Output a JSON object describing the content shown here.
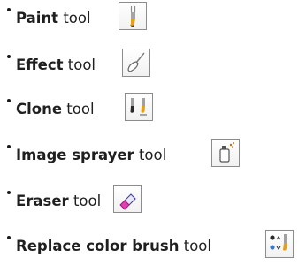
{
  "tool_list": {
    "items": [
      {
        "name": "Paint",
        "suffix": "tool",
        "icon": "paint-brush-icon"
      },
      {
        "name": "Effect",
        "suffix": "tool",
        "icon": "effect-brush-icon"
      },
      {
        "name": "Clone",
        "suffix": "tool",
        "icon": "clone-brushes-icon"
      },
      {
        "name": "Image sprayer",
        "suffix": "tool",
        "icon": "image-sprayer-icon"
      },
      {
        "name": "Eraser",
        "suffix": "tool",
        "icon": "eraser-icon"
      },
      {
        "name": "Replace color brush",
        "suffix": "tool",
        "icon": "replace-color-brush-icon"
      }
    ]
  }
}
